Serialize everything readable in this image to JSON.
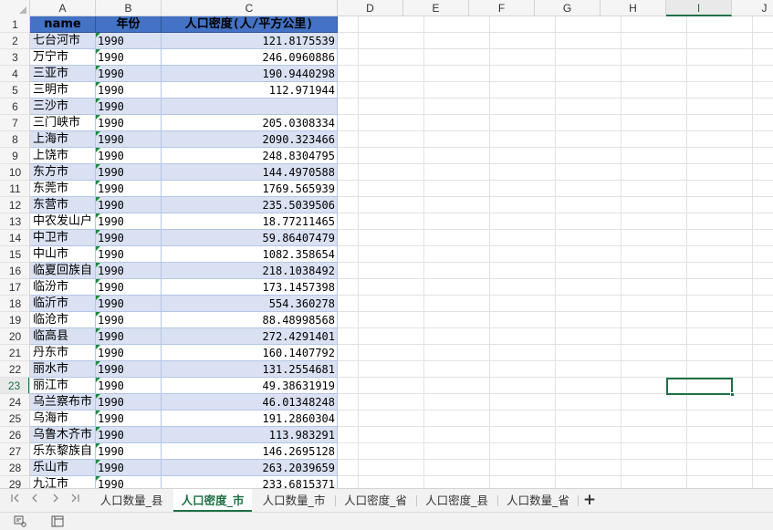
{
  "columns": [
    "A",
    "B",
    "C",
    "D",
    "E",
    "F",
    "G",
    "H",
    "I",
    "J"
  ],
  "selected_column": "I",
  "selected_row": "23",
  "row_numbers": [
    "1",
    "2",
    "3",
    "4",
    "5",
    "6",
    "7",
    "8",
    "9",
    "10",
    "11",
    "12",
    "13",
    "14",
    "15",
    "16",
    "17",
    "18",
    "19",
    "20",
    "21",
    "22",
    "23",
    "24",
    "25",
    "26",
    "27",
    "28",
    "29"
  ],
  "table": {
    "headers": [
      "name",
      "年份",
      "人口密度(人/平方公里)"
    ],
    "rows": [
      {
        "name": "七台河市",
        "year": "1990",
        "density": "121.8175539"
      },
      {
        "name": "万宁市",
        "year": "1990",
        "density": "246.0960886"
      },
      {
        "name": "三亚市",
        "year": "1990",
        "density": "190.9440298"
      },
      {
        "name": "三明市",
        "year": "1990",
        "density": "112.971944"
      },
      {
        "name": "三沙市",
        "year": "1990",
        "density": ""
      },
      {
        "name": "三门峡市",
        "year": "1990",
        "density": "205.0308334"
      },
      {
        "name": "上海市",
        "year": "1990",
        "density": "2090.323466"
      },
      {
        "name": "上饶市",
        "year": "1990",
        "density": "248.8304795"
      },
      {
        "name": "东方市",
        "year": "1990",
        "density": "144.4970588"
      },
      {
        "name": "东莞市",
        "year": "1990",
        "density": "1769.565939"
      },
      {
        "name": "东营市",
        "year": "1990",
        "density": "235.5039506"
      },
      {
        "name": "中农发山户",
        "year": "1990",
        "density": "18.77211465"
      },
      {
        "name": "中卫市",
        "year": "1990",
        "density": "59.86407479"
      },
      {
        "name": "中山市",
        "year": "1990",
        "density": "1082.358654"
      },
      {
        "name": "临夏回族自",
        "year": "1990",
        "density": "218.1038492"
      },
      {
        "name": "临汾市",
        "year": "1990",
        "density": "173.1457398"
      },
      {
        "name": "临沂市",
        "year": "1990",
        "density": "554.360278"
      },
      {
        "name": "临沧市",
        "year": "1990",
        "density": "88.48998568"
      },
      {
        "name": "临高县",
        "year": "1990",
        "density": "272.4291401"
      },
      {
        "name": "丹东市",
        "year": "1990",
        "density": "160.1407792"
      },
      {
        "name": "丽水市",
        "year": "1990",
        "density": "131.2554681"
      },
      {
        "name": "丽江市",
        "year": "1990",
        "density": "49.38631919"
      },
      {
        "name": "乌兰察布市",
        "year": "1990",
        "density": "46.01348248"
      },
      {
        "name": "乌海市",
        "year": "1990",
        "density": "191.2860304"
      },
      {
        "name": "乌鲁木齐市",
        "year": "1990",
        "density": "113.983291"
      },
      {
        "name": "乐东黎族自",
        "year": "1990",
        "density": "146.2695128"
      },
      {
        "name": "乐山市",
        "year": "1990",
        "density": "263.2039659"
      },
      {
        "name": "九江市",
        "year": "1990",
        "density": "233.6815371"
      }
    ]
  },
  "sheet_nav": [
    "first-sheet-icon",
    "prev-sheet-icon",
    "next-sheet-icon",
    "last-sheet-icon"
  ],
  "sheet_tabs": [
    {
      "label": "人口数量_县",
      "active": false
    },
    {
      "label": "人口密度_市",
      "active": true
    },
    {
      "label": "人口数量_市",
      "active": false
    },
    {
      "label": "人口密度_省",
      "active": false
    },
    {
      "label": "人口密度_县",
      "active": false
    },
    {
      "label": "人口数量_省",
      "active": false
    }
  ],
  "add_sheet_label": "+",
  "status_icons": [
    "macro-record-icon",
    "sheet-view-icon"
  ],
  "colors": {
    "header_fill": "#4472c4",
    "band_fill": "#d9e1f2",
    "accent": "#1e7145",
    "error_flag": "#1e8a3e"
  }
}
